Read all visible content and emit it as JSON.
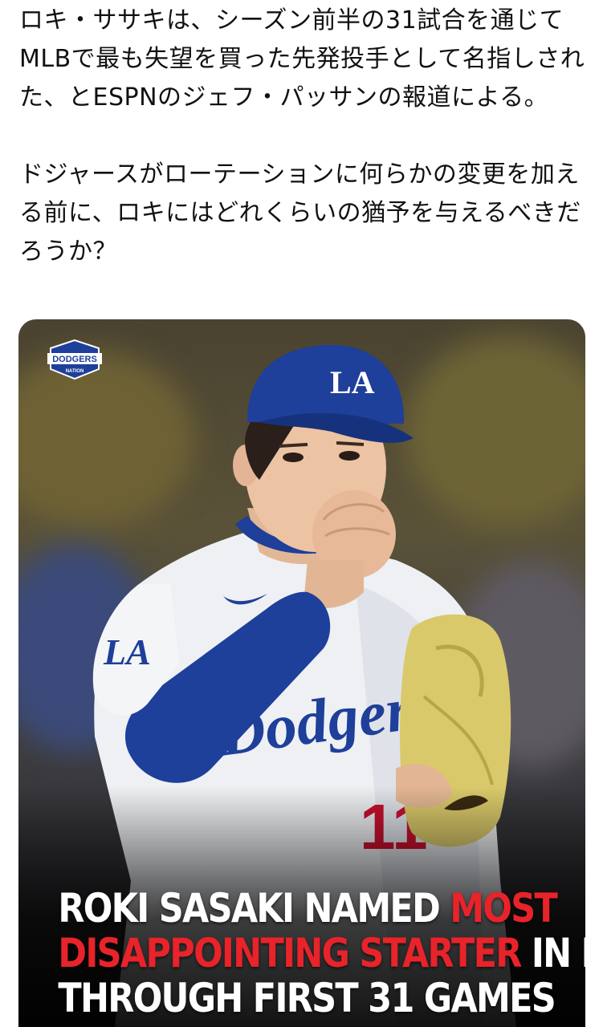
{
  "post": {
    "paragraph1": "ロキ・ササキは、シーズン前半の31試合を通じてMLBで最も失望を買った先発投手として名指しされた、とESPNのジェフ・パッサンの報道による。",
    "paragraph2": "ドジャースがローテーションに何らかの変更を加える前に、ロキにはどれくらいの猶予を与えるべきだろうか？"
  },
  "media": {
    "logo_text": "DODGERS",
    "logo_subtext": "NATION",
    "cap_logo": "LA",
    "sleeve_logo": "LA",
    "jersey_text": "Dodgers",
    "jersey_number": "11",
    "headline": {
      "line1_white": "ROKI SASAKI NAMED ",
      "line1_red": "MOST",
      "line2_red": "DISAPPOINTING STARTER",
      "line2_white": " IN MLB",
      "line3_white": "THROUGH FIRST 31 GAMES"
    }
  },
  "colors": {
    "dodger_blue": "#1e3f9a",
    "headline_red": "#e8232a",
    "glove_yellow": "#d9c96a"
  }
}
